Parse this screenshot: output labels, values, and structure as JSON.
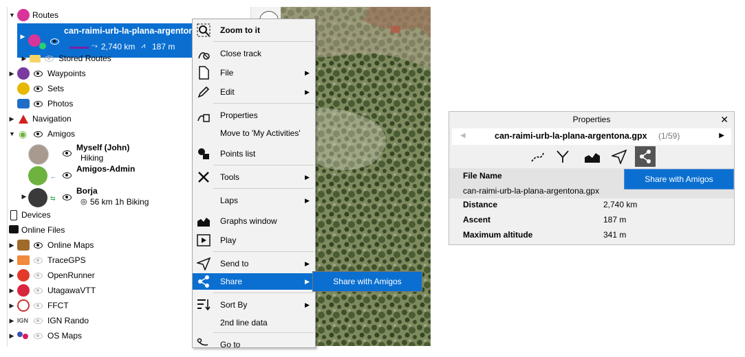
{
  "tree": {
    "routes_label": "Routes",
    "route": {
      "name": "can-raimi-urb-la-plana-argentona",
      "distance": "2,740 km",
      "ascent": "187 m"
    },
    "stored_routes": "Stored Routes",
    "waypoints": "Waypoints",
    "sets": "Sets",
    "photos": "Photos",
    "navigation": "Navigation",
    "amigos": "Amigos",
    "amigo1": {
      "name": "Myself (John)",
      "activity": "Hiking"
    },
    "amigo2": {
      "name": "Amigos-Admin"
    },
    "amigo3": {
      "name": "Borja",
      "stats": "56 km 1h Biking"
    },
    "devices": "Devices",
    "online_files": "Online Files",
    "online_maps": "Online Maps",
    "tracegps": "TraceGPS",
    "openrunner": "OpenRunner",
    "utagawavtt": "UtagawaVTT",
    "ffct": "FFCT",
    "ign_rando": "IGN Rando",
    "ign_logo": "IGN",
    "os_maps": "OS Maps"
  },
  "context_menu": {
    "zoom": "Zoom to it",
    "close_track": "Close track",
    "file": "File",
    "edit": "Edit",
    "properties": "Properties",
    "move_to": "Move to 'My Activities'",
    "points_list": "Points list",
    "tools": "Tools",
    "laps": "Laps",
    "graphs": "Graphs window",
    "play": "Play",
    "send_to": "Send to",
    "share": "Share",
    "sort_by": "Sort By",
    "second_line": "2nd line data",
    "go_to": "Go to"
  },
  "submenu": {
    "share_amigos": "Share with Amigos"
  },
  "properties": {
    "title": "Properties",
    "file_title": "can-raimi-urb-la-plana-argentona.gpx",
    "counter": "(1/59)",
    "rows": [
      {
        "key": "File Name",
        "value": "can-raimi-urb-la-plana-argentona.gpx"
      },
      {
        "key": "Distance",
        "value": "2,740 km"
      },
      {
        "key": "Ascent",
        "value": "187 m"
      },
      {
        "key": "Maximum altitude",
        "value": "341 m"
      }
    ],
    "share_tip": "Share with Amigos"
  },
  "colors": {
    "accent": "#0a6fd1",
    "routes_icon": "#d9349a",
    "waypoints_icon": "#7b3aa0",
    "sets_icon": "#e8b800",
    "amigos_green": "#6eb33f"
  }
}
